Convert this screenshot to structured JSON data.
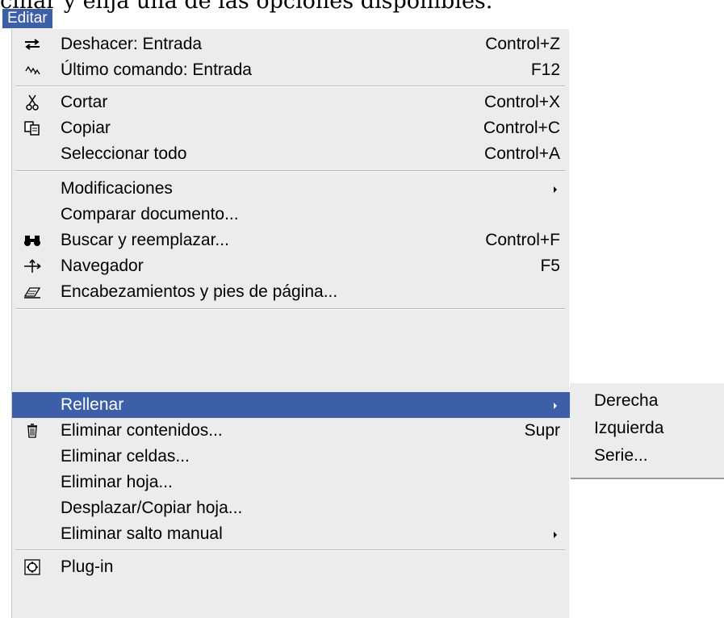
{
  "document_text": "cinar y elija una de las opciones disponibles.",
  "menu_title": "Editar",
  "menu": {
    "items": [
      {
        "label": "Deshacer: Entrada",
        "shortcut": "Control+Z",
        "icon": "undo-icon"
      },
      {
        "label": "Último comando: Entrada",
        "shortcut": "F12",
        "icon": "repeat-icon"
      },
      {
        "label": "Cortar",
        "shortcut": "Control+X",
        "icon": "scissors-icon"
      },
      {
        "label": "Copiar",
        "shortcut": "Control+C",
        "icon": "copy-icon"
      },
      {
        "label": "Seleccionar todo",
        "shortcut": "Control+A"
      },
      {
        "label": "Modificaciones",
        "submenu": true
      },
      {
        "label": "Comparar documento..."
      },
      {
        "label": "Buscar y reemplazar...",
        "shortcut": "Control+F",
        "icon": "binoculars-icon"
      },
      {
        "label": "Navegador",
        "shortcut": "F5",
        "icon": "navigator-icon"
      },
      {
        "label": "Encabezamientos y pies de página...",
        "icon": "header-footer-icon"
      },
      {
        "label": "Rellenar",
        "submenu": true,
        "active": true
      },
      {
        "label": "Eliminar contenidos...",
        "shortcut": "Supr",
        "icon": "trash-icon"
      },
      {
        "label": "Eliminar celdas..."
      },
      {
        "label": "Eliminar hoja..."
      },
      {
        "label": "Desplazar/Copiar hoja..."
      },
      {
        "label": "Eliminar salto manual",
        "submenu": true
      },
      {
        "label": "Plug-in",
        "icon": "plugin-icon"
      }
    ]
  },
  "submenu": {
    "items": [
      "Derecha",
      "Izquierda",
      "Serie..."
    ]
  },
  "colors": {
    "highlight": "#3c5fa8",
    "menu_background": "#ececec"
  }
}
